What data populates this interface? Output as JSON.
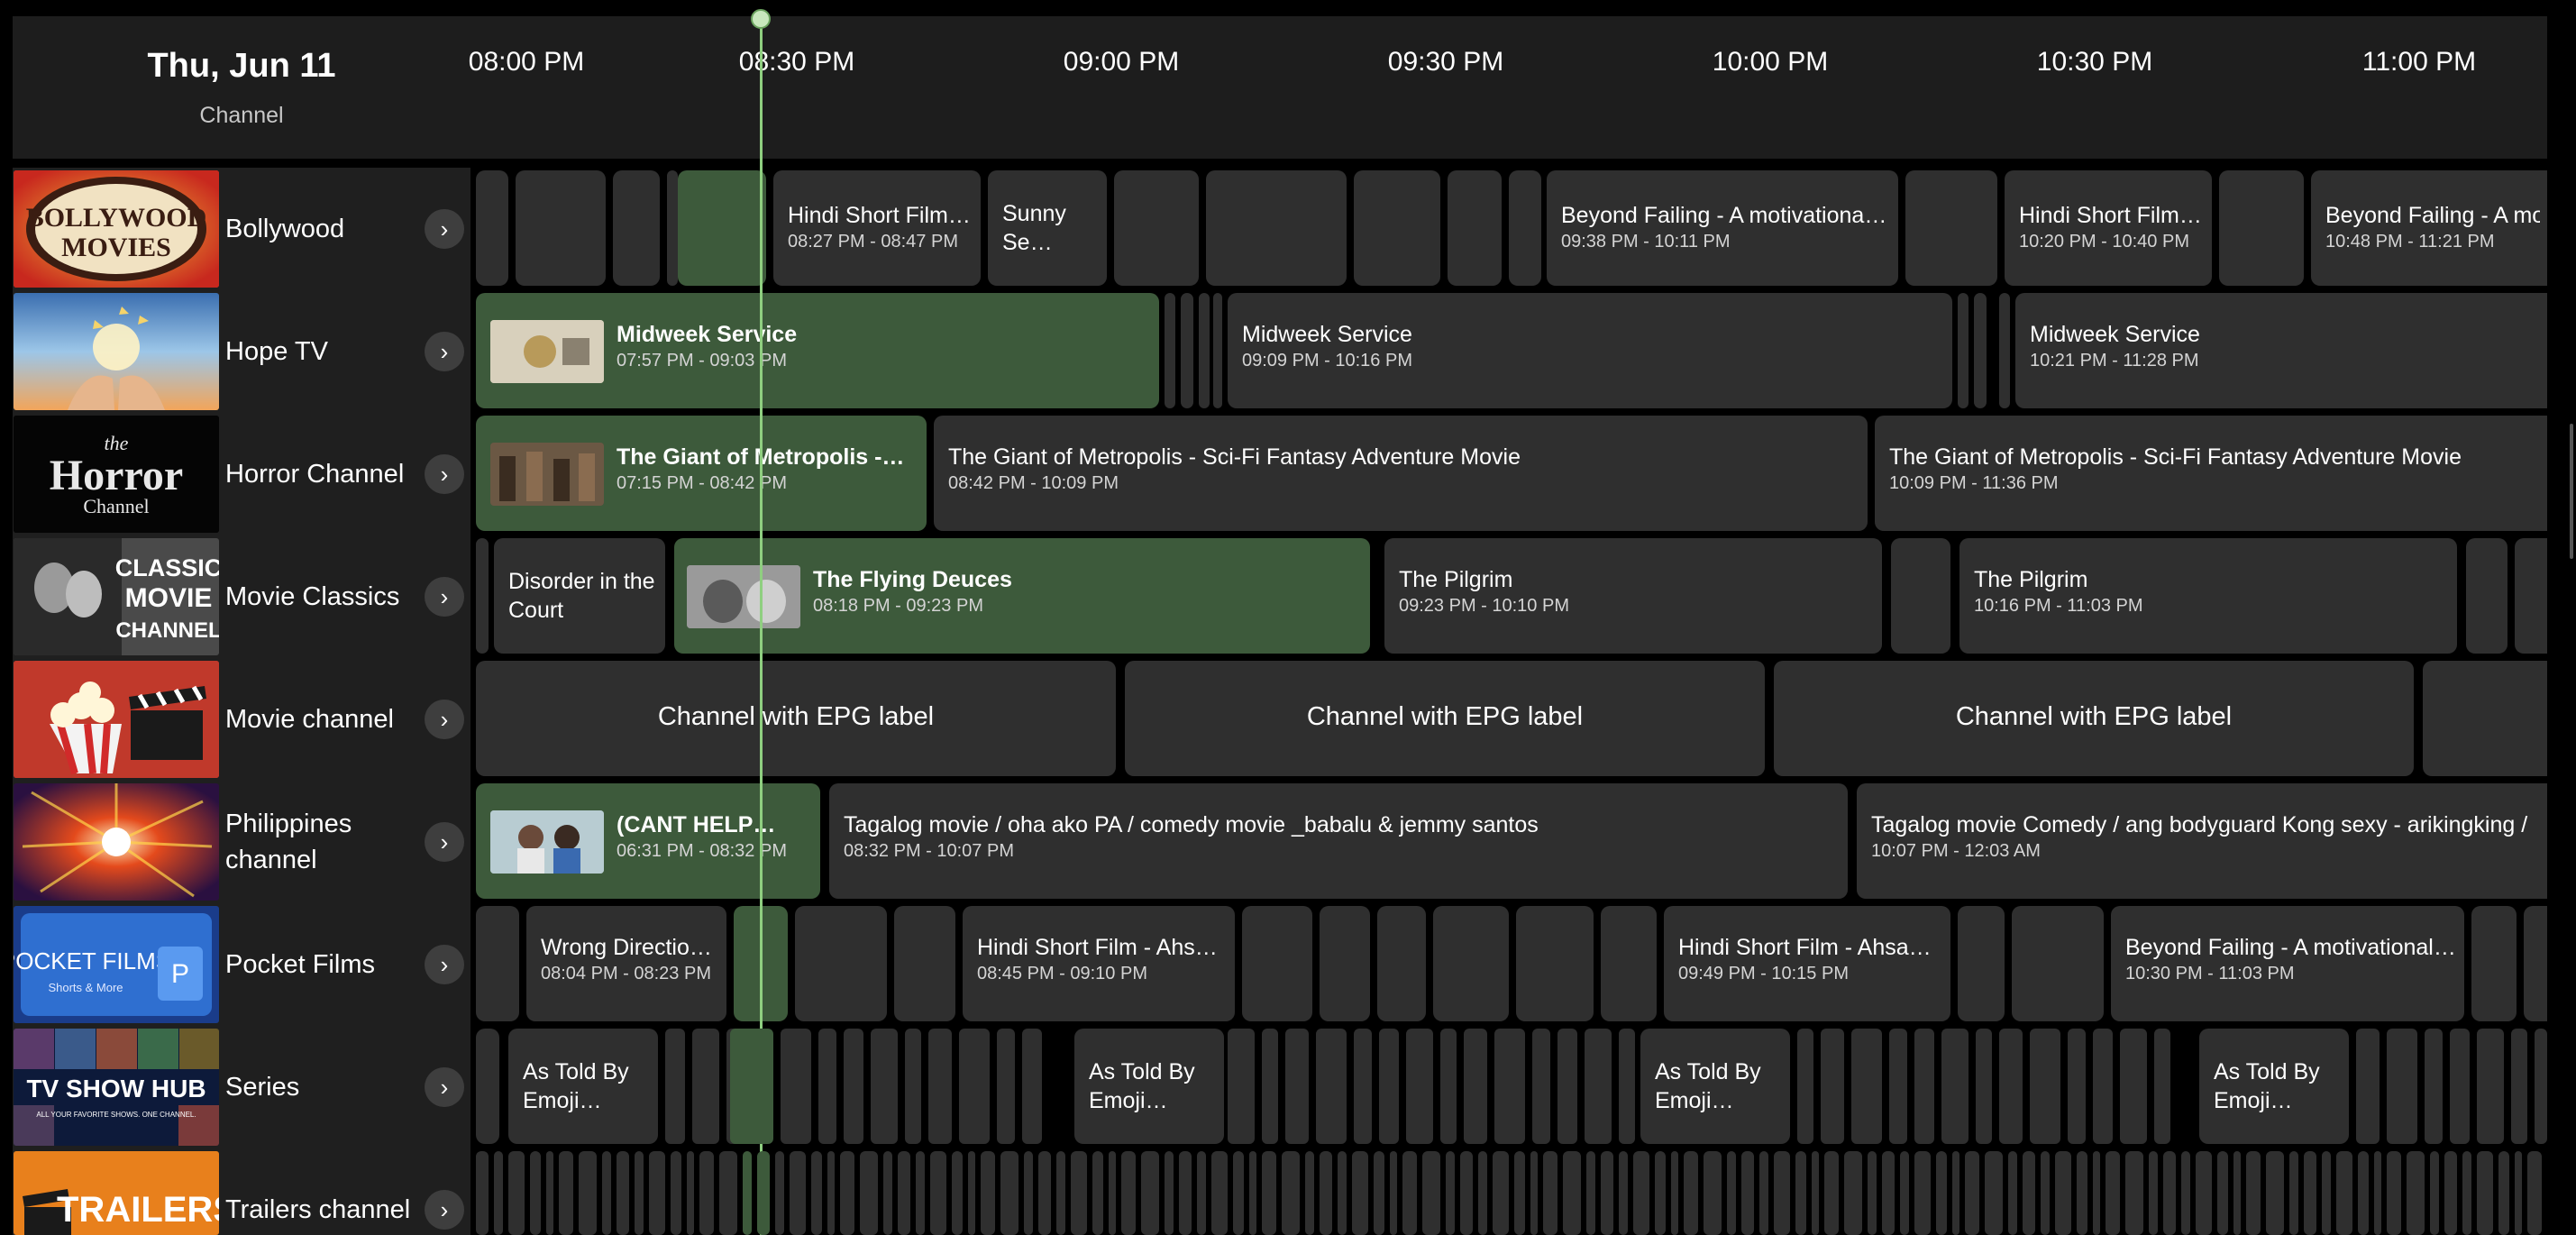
{
  "header": {
    "date": "Thu, Jun 11",
    "channel_label": "Channel",
    "times": [
      "08:00 PM",
      "08:30 PM",
      "09:00 PM",
      "09:30 PM",
      "10:00 PM",
      "10:30 PM",
      "11:00 PM"
    ]
  },
  "channels": [
    {
      "name": "Bollywood",
      "logo_text": "BOLLYWOOD MOVIES",
      "logo_icon": "bollywood-movies-logo",
      "arrow": "›"
    },
    {
      "name": "Hope TV",
      "logo_text": "",
      "logo_icon": "hope-tv-hands-logo",
      "arrow": "›"
    },
    {
      "name": "Horror Channel",
      "logo_text": "the Horror Channel",
      "logo_icon": "horror-channel-logo",
      "arrow": "›"
    },
    {
      "name": "Movie Classics",
      "logo_text": "CLASSIC MOVIE CHANNEL",
      "logo_icon": "classic-movie-logo",
      "arrow": "›"
    },
    {
      "name": "Movie channel",
      "logo_text": "",
      "logo_icon": "popcorn-clapper-logo",
      "arrow": "›"
    },
    {
      "name": "Philippines channel",
      "logo_text": "",
      "logo_icon": "philippines-channel-logo",
      "arrow": "›"
    },
    {
      "name": "Pocket Films",
      "logo_text": "POCKET FILMS",
      "logo_sub": "Shorts & More",
      "logo_icon": "pocket-films-logo",
      "arrow": "›"
    },
    {
      "name": "Series",
      "logo_text": "TV SHOW HUB",
      "logo_sub": "ALL YOUR FAVORITE SHOWS. ONE CHANNEL.",
      "logo_icon": "tv-show-hub-logo",
      "arrow": "›"
    },
    {
      "name": "Trailers channel",
      "logo_text": "TRAILERS",
      "logo_icon": "trailers-logo",
      "arrow": "›"
    }
  ],
  "programs": {
    "bollywood": [
      {
        "title": "Hindi Short Film…",
        "time": "08:27 PM - 08:47 PM"
      },
      {
        "title": "Sunny Se…"
      },
      {
        "title": "Beyond Failing - A motivational…",
        "time": "09:38 PM - 10:11 PM"
      },
      {
        "title": "Hindi Short Film…",
        "time": "10:20 PM - 10:40 PM"
      },
      {
        "title": "Beyond Failing - A motiv…",
        "time": "10:48 PM - 11:21 PM"
      }
    ],
    "hope": [
      {
        "title": "Midweek Service",
        "time": "07:57 PM - 09:03 PM"
      },
      {
        "title": "Midweek Service",
        "time": "09:09 PM - 10:16 PM"
      },
      {
        "title": "Midweek Service",
        "time": "10:21 PM - 11:28 PM"
      }
    ],
    "horror": [
      {
        "title": "The Giant of Metropolis -…",
        "time": "07:15 PM - 08:42 PM"
      },
      {
        "title": "The Giant of Metropolis - Sci-Fi Fantasy Adventure Movie",
        "time": "08:42 PM - 10:09 PM"
      },
      {
        "title": "The Giant of Metropolis - Sci-Fi Fantasy Adventure Movie",
        "time": "10:09 PM - 11:36 PM"
      }
    ],
    "classics": [
      {
        "title": "Disorder in the Court"
      },
      {
        "title": "The Flying Deuces",
        "time": "08:18 PM - 09:23 PM"
      },
      {
        "title": "The Pilgrim",
        "time": "09:23 PM - 10:10 PM"
      },
      {
        "title": "The Pilgrim",
        "time": "10:16 PM - 11:03 PM"
      }
    ],
    "movie": [
      {
        "title": "Channel with EPG label"
      },
      {
        "title": "Channel with EPG label"
      },
      {
        "title": "Channel with EPG label"
      }
    ],
    "philippines": [
      {
        "title": "(CANT HELP…",
        "time": "06:31 PM - 08:32 PM"
      },
      {
        "title": "Tagalog movie / oha ako PA / comedy movie _babalu & jemmy santos",
        "time": "08:32 PM - 10:07 PM"
      },
      {
        "title": "Tagalog movie Comedy / ang bodyguard Kong sexy - arikingking /",
        "time": "10:07 PM - 12:03 AM"
      }
    ],
    "pocket": [
      {
        "title": "Wrong Directio…",
        "time": "08:04 PM - 08:23 PM"
      },
      {
        "title": "Hindi Short Film - Ahsa…",
        "time": "08:45 PM - 09:10 PM"
      },
      {
        "title": "Hindi Short Film - Ahsa…",
        "time": "09:49 PM - 10:15 PM"
      },
      {
        "title": "Beyond Failing - A motivational…",
        "time": "10:30 PM - 11:03 PM"
      }
    ],
    "series": [
      {
        "title": "As Told By Emoji…"
      },
      {
        "title": "As Told By Emoji…"
      },
      {
        "title": "As Told By Emoji…"
      },
      {
        "title": "As Told By Emoji…"
      }
    ]
  },
  "colors": {
    "background": "#000000",
    "panel": "#1d1d1d",
    "program": "#2f2f2f",
    "program_live": "#3d5a3b",
    "now_line": "#8fcf80"
  }
}
